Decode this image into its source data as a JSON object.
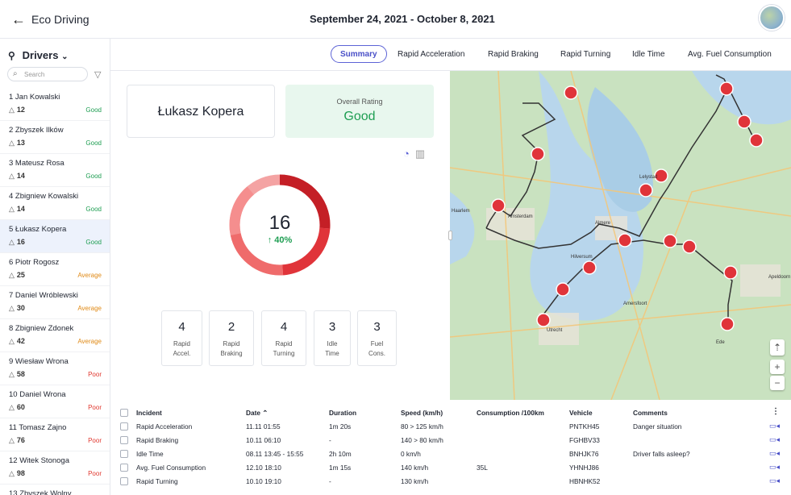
{
  "header": {
    "back_label": "←",
    "title": "Eco Driving",
    "date_range": "September 24, 2021 - October 8, 2021",
    "date_chevron": "⌄"
  },
  "sidebar": {
    "heading": "Drivers",
    "search_placeholder": "Search",
    "drivers": [
      {
        "name": "1 Jan Kowalski",
        "count": "12",
        "rating": "Good"
      },
      {
        "name": "2 Zbyszek Ilków",
        "count": "13",
        "rating": "Good"
      },
      {
        "name": "3 Mateusz Rosa",
        "count": "14",
        "rating": "Good"
      },
      {
        "name": "4 Zbigniew Kowalski",
        "count": "14",
        "rating": "Good"
      },
      {
        "name": "5 Łukasz Kopera",
        "count": "16",
        "rating": "Good"
      },
      {
        "name": "6 Piotr Rogosz",
        "count": "25",
        "rating": "Average"
      },
      {
        "name": "7 Daniel Wróblewski",
        "count": "30",
        "rating": "Average"
      },
      {
        "name": "8 Zbigniew Zdonek",
        "count": "42",
        "rating": "Average"
      },
      {
        "name": "9 Wiesław Wrona",
        "count": "58",
        "rating": "Poor"
      },
      {
        "name": "10 Daniel Wrona",
        "count": "60",
        "rating": "Poor"
      },
      {
        "name": "11 Tomasz Zajno",
        "count": "76",
        "rating": "Poor"
      },
      {
        "name": "12 Witek Stonoga",
        "count": "98",
        "rating": "Poor"
      },
      {
        "name": "13 Zbyszek Wolny",
        "count": "",
        "rating": ""
      }
    ],
    "active_index": 4
  },
  "colors": {
    "Good": "#1e9e52",
    "Average": "#e08a16",
    "Poor": "#e0382f",
    "accent": "#5c63d6"
  },
  "tabs": [
    {
      "label": "Summary",
      "active": true
    },
    {
      "label": "Rapid Acceleration"
    },
    {
      "label": "Rapid Braking"
    },
    {
      "label": "Rapid Turning"
    },
    {
      "label": "Idle Time"
    },
    {
      "label": "Avg. Fuel Consumption"
    }
  ],
  "summary": {
    "driver_name": "Łukasz Kopera",
    "overall_rating_label": "Overall Rating",
    "overall_rating": "Good",
    "total": "16",
    "change": "40%",
    "stats": [
      {
        "value": "4",
        "label": "Rapid\nAccel."
      },
      {
        "value": "2",
        "label": "Rapid\nBraking"
      },
      {
        "value": "4",
        "label": "Rapid\nTurning"
      },
      {
        "value": "3",
        "label": "Idle\nTime"
      },
      {
        "value": "3",
        "label": "Fuel\nCons."
      }
    ]
  },
  "map": {
    "labels": [
      "Amsterdam",
      "Utrecht",
      "Amersfoort",
      "Almere",
      "Lelystad",
      "Apeldoorn",
      "Hilversum",
      "Haarlem",
      "Ede"
    ]
  },
  "table": {
    "columns": [
      "Incident",
      "Date",
      "Duration",
      "Speed (km/h)",
      "Consumption /100km",
      "Vehicle",
      "Comments"
    ],
    "sort_indicator": "⌃",
    "rows": [
      {
        "incident": "Rapid Acceleration",
        "date": "11.11  01:55",
        "duration": "1m 20s",
        "speed": "80 > 125 km/h",
        "consumption": "",
        "vehicle": "PNTKH45",
        "comment": "Danger situation"
      },
      {
        "incident": "Rapid Braking",
        "date": "10.11  06:10",
        "duration": "-",
        "speed": "140 > 80 km/h",
        "consumption": "",
        "vehicle": "FGHBV33",
        "comment": ""
      },
      {
        "incident": "Idle Time",
        "date": "08.11  13:45 - 15:55",
        "duration": "2h 10m",
        "speed": "0 km/h",
        "consumption": "",
        "vehicle": "BNHJK76",
        "comment": "Driver falls asleep?"
      },
      {
        "incident": "Avg. Fuel Consumption",
        "date": "12.10  18:10",
        "duration": "1m 15s",
        "speed": "140 km/h",
        "consumption": "35L",
        "vehicle": "YHNHJ86",
        "comment": ""
      },
      {
        "incident": "Rapid Turning",
        "date": "10.10  19:10",
        "duration": "-",
        "speed": "130 km/h",
        "consumption": "",
        "vehicle": "HBNHK52",
        "comment": ""
      }
    ]
  }
}
